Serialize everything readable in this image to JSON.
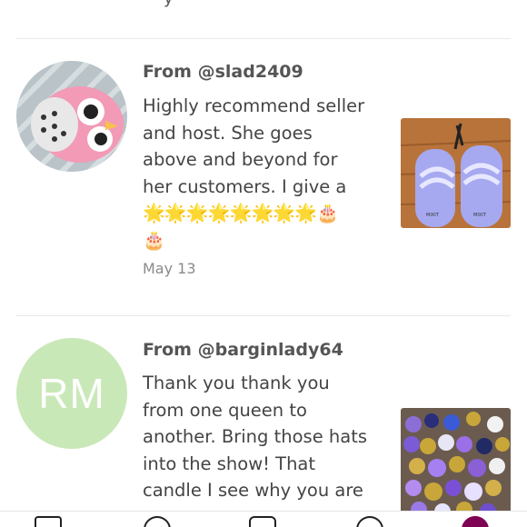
{
  "top": {
    "cut_text": "y"
  },
  "reviews": [
    {
      "from": "From @slad2409",
      "lines": [
        "Highly recommend seller",
        "and host. She goes",
        "above and beyond for",
        "her customers. I give a"
      ],
      "emoji_line1": "🌟🌟🌟🌟🌟🌟🌟🌟🎂",
      "emoji_line2": "🎂",
      "date": "May 13",
      "avatar_icon": "owl-avatar-icon",
      "thumb_icon": "lavender-sandals-photo"
    },
    {
      "from": "From @barginlady64",
      "avatar_initials": "RM",
      "lines": [
        "Thank you thank you",
        "from one queen to",
        "another. Bring those hats",
        "into the show! That",
        "candle I see why you are"
      ],
      "thumb_icon": "party-balloons-photo"
    }
  ],
  "bottom_nav": {
    "items": [
      "profile-icon",
      "search-icon",
      "camera-icon",
      "chat-icon",
      "account-icon"
    ],
    "active_color": "#7f0353"
  }
}
